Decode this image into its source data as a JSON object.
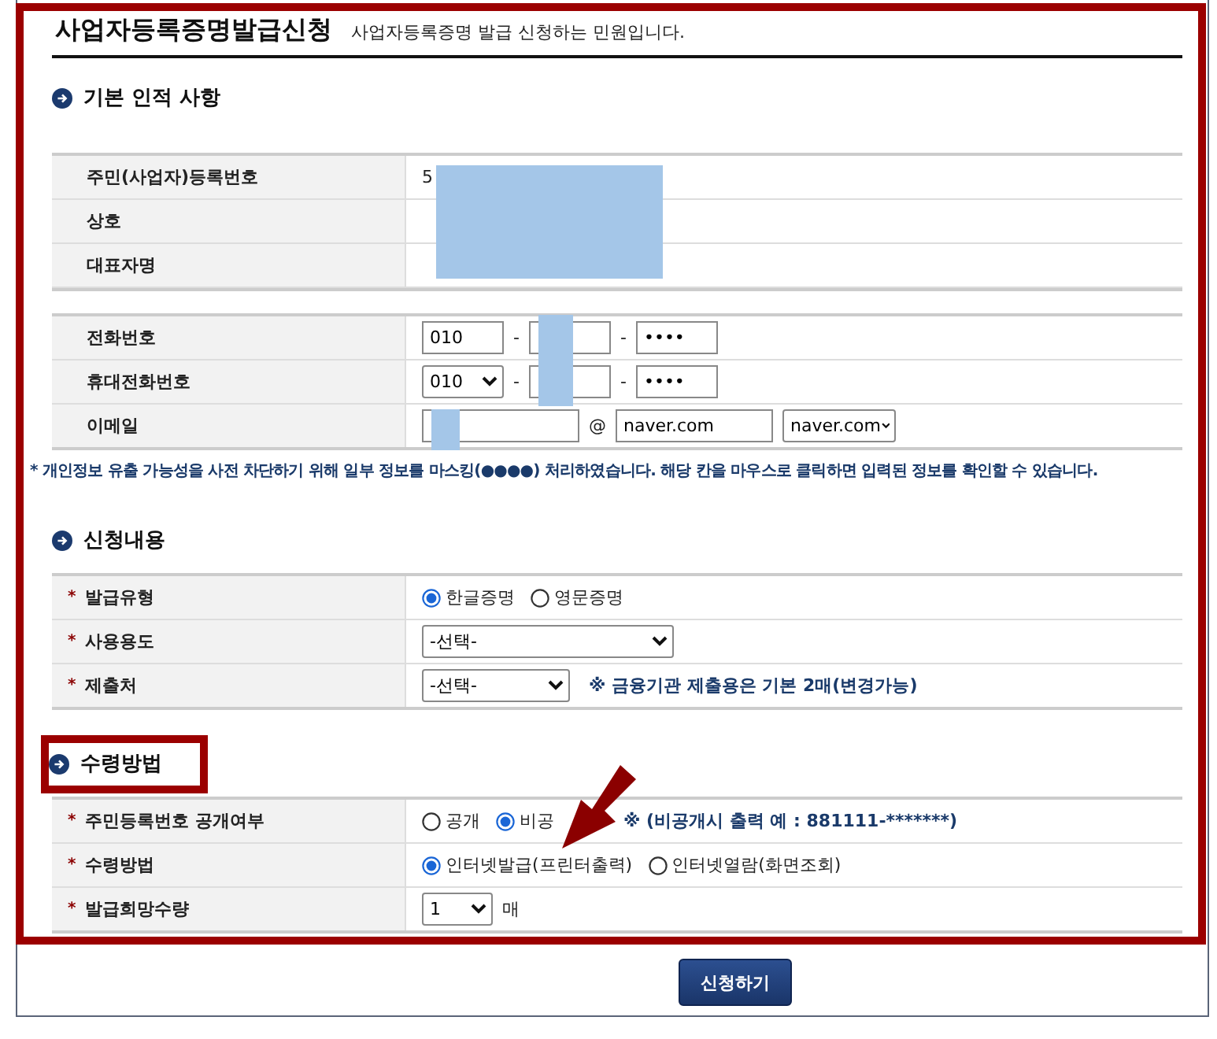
{
  "header": {
    "title": "사업자등록증명발급신청",
    "description": "사업자등록증명 발급 신청하는 민원입니다."
  },
  "sections": [
    {
      "title": "기본 인적 사항",
      "highlighted": false,
      "arrow": false,
      "groups": [
        {
          "redacted": true,
          "rows": [
            {
              "label": "주민(사업자)등록번호",
              "kind": "text",
              "value": "5"
            },
            {
              "label": "상호",
              "kind": "text"
            },
            {
              "label": "대표자명",
              "kind": "text"
            }
          ]
        },
        {
          "redacted": false,
          "rows": [
            {
              "label": "전화번호",
              "kind": "phone",
              "separator": "-",
              "parts": [
                {
                  "kind": "input",
                  "value": "010",
                  "redacted": false
                },
                {
                  "kind": "input",
                  "redacted": true
                },
                {
                  "kind": "input",
                  "value": "••••",
                  "redacted": false
                }
              ]
            },
            {
              "label": "휴대전화번호",
              "kind": "phone",
              "separator": "-",
              "parts": [
                {
                  "kind": "select",
                  "value": "010",
                  "redacted": false
                },
                {
                  "kind": "input",
                  "redacted": true
                },
                {
                  "kind": "input",
                  "value": "••••",
                  "redacted": false
                }
              ]
            },
            {
              "label": "이메일",
              "kind": "email",
              "at": "@",
              "local": {
                "redacted": true
              },
              "domain": "naver.com",
              "domain_select": "naver.com"
            }
          ]
        }
      ],
      "notice": "* 개인정보 유출 가능성을 사전 차단하기 위해 일부 정보를 마스킹(●●●●) 처리하였습니다. 해당 칸을 마우스로 클릭하면 입력된 정보를 확인할 수 있습니다."
    },
    {
      "title": "신청내용",
      "highlighted": false,
      "arrow": false,
      "groups": [
        {
          "redacted": false,
          "rows": [
            {
              "mark": "*",
              "label": "발급유형",
              "kind": "radio",
              "options": [
                {
                  "label": "한글증명",
                  "selected": true
                },
                {
                  "label": "영문증명",
                  "selected": false
                }
              ]
            },
            {
              "mark": "*",
              "label": "사용용도",
              "kind": "select",
              "value": "-선택-"
            },
            {
              "mark": "*",
              "label": "제출처",
              "kind": "select",
              "value": "-선택-",
              "note": "※ 금융기관 제출용은 기본 2매(변경가능)"
            }
          ]
        }
      ]
    },
    {
      "title": "수령방법",
      "highlighted": true,
      "arrow": true,
      "groups": [
        {
          "redacted": false,
          "rows": [
            {
              "mark": "*",
              "label": "주민등록번호 공개여부",
              "kind": "radio",
              "options": [
                {
                  "label": "공개",
                  "selected": false
                },
                {
                  "label": "비공",
                  "selected": true
                }
              ],
              "note": "※ (비공개시 출력 예 : 881111-*******)"
            },
            {
              "mark": "*",
              "label": "수령방법",
              "kind": "radio",
              "options": [
                {
                  "label": "인터넷발급(프린터출력)",
                  "selected": true
                },
                {
                  "label": "인터넷열람(화면조회)",
                  "selected": false
                }
              ]
            },
            {
              "mark": "*",
              "label": "발급희망수량",
              "kind": "select",
              "value": "1",
              "suffix": "매"
            }
          ]
        }
      ]
    }
  ],
  "submit": {
    "label": "신청하기"
  }
}
